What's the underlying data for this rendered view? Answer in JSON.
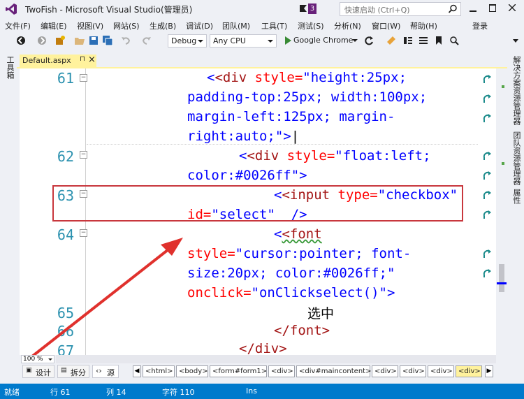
{
  "window": {
    "title": "TwoFish - Microsoft Visual Studio(管理员)",
    "notification_count": "3",
    "quick_launch_placeholder": "快速启动 (Ctrl+Q)"
  },
  "menu": [
    "文件(F)",
    "编辑(E)",
    "视图(V)",
    "网站(S)",
    "生成(B)",
    "调试(D)",
    "团队(M)",
    "工具(T)",
    "测试(S)",
    "分析(N)",
    "窗口(W)",
    "帮助(H)"
  ],
  "signin": "登录",
  "toolbar": {
    "config": "Debug",
    "platform": "Any CPU",
    "run_label": "Google Chrome"
  },
  "left_strip": {
    "toolbox": "工具箱"
  },
  "right_strip": {
    "solution_explorer": "解决方案资源管理器",
    "team_explorer": "团队资源管理器",
    "properties": "属性"
  },
  "tab": {
    "filename": "Default.aspx",
    "pin": "⊓",
    "close": "×"
  },
  "editor": {
    "lines": [
      {
        "num": "61",
        "l1a": "<div",
        "l1b": " style=",
        "l1c": "\"height:25px;",
        "l2": "padding-top:25px; width:100px;",
        "l3": "margin-left:125px; margin-",
        "l4": "right:auto;\"",
        "l4b": ">"
      },
      {
        "num": "62",
        "l1a": "<div",
        "l1b": " style=",
        "l1c": "\"float:left;",
        "l2": "color:#0026ff\"",
        "l2b": ">"
      },
      {
        "num": "63",
        "l1a": "<input",
        "l1b": " type=",
        "l1c": "\"checkbox\"",
        "l2a": "id=",
        "l2b": "\"select\"",
        "l2c": "  />"
      },
      {
        "num": "64",
        "l1a": "<font",
        "l2a": "style=",
        "l2b": "\"cursor:pointer; font-",
        "l3": "size:20px; color:#0026ff;\"",
        "l4a": "onclick=",
        "l4b": "\"onClickselect()\"",
        "l4c": ">"
      },
      {
        "num": "65",
        "text": "选中"
      },
      {
        "num": "66",
        "close": "</font>"
      },
      {
        "num": "67",
        "close": "</div>"
      }
    ]
  },
  "zoom": "100 %",
  "views": {
    "design": "设计",
    "split": "拆分",
    "source": "源"
  },
  "breadcrumb": [
    "<html>",
    "<body>",
    "<form#form1>",
    "<div>",
    "<div#maincontent>",
    "<div>",
    "<div>",
    "<div>",
    "<div>"
  ],
  "status": {
    "state": "就绪",
    "line": "行 61",
    "col": "列 14",
    "char": "字符 110",
    "mode": "Ins"
  },
  "colors": {
    "status_blue": "#007acc",
    "tab_yellow": "#fff29d",
    "highlight_red": "#c8373d",
    "tag_maroon": "#a31515",
    "attr_red": "#ff0000",
    "value_blue": "#0000ff",
    "line_number": "#2b91af"
  }
}
